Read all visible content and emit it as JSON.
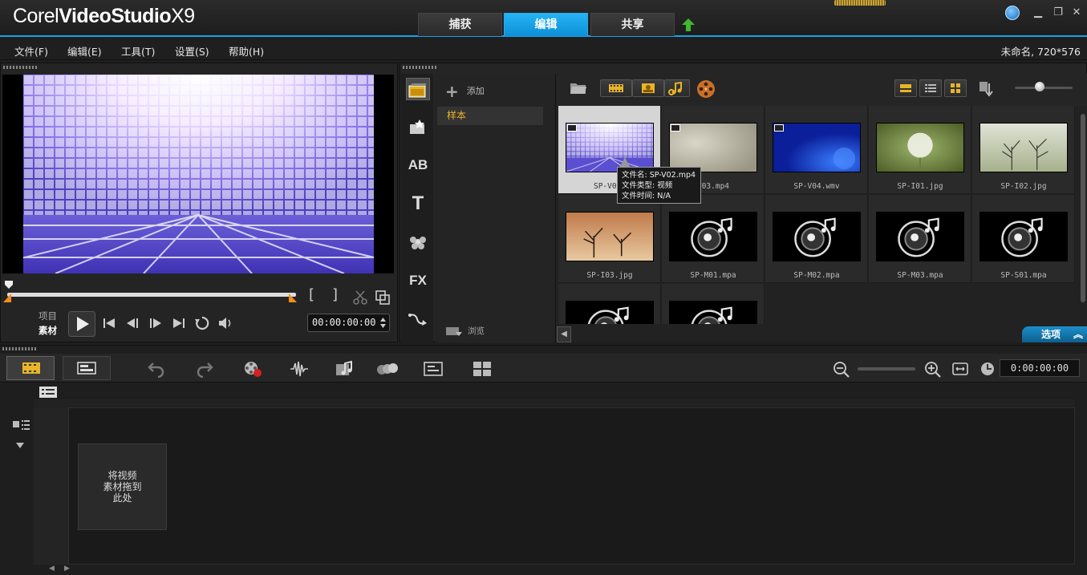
{
  "app": {
    "brand_1": "Corel",
    "brand_2": "VideoStudio",
    "brand_3": "X9",
    "accent": "#1aa2e6"
  },
  "mode_tabs": [
    {
      "label": "捕获",
      "active": false
    },
    {
      "label": "编辑",
      "active": true
    },
    {
      "label": "共享",
      "active": false
    }
  ],
  "menu": {
    "items": [
      "文件(F)",
      "编辑(E)",
      "工具(T)",
      "设置(S)",
      "帮助(H)"
    ],
    "project_info": "未命名, 720*576"
  },
  "player": {
    "mode_project": "项目",
    "mode_clip": "素材",
    "timecode": "00:00:00:00"
  },
  "library": {
    "add_label": "添加",
    "folder": "样本",
    "browse_label": "浏览",
    "options_label": "选项",
    "items": [
      {
        "name": "SP-V02.mp4",
        "label": "SP-V02.",
        "kind": "video",
        "selected": true
      },
      {
        "name": "SP-V03.mp4",
        "label": "V03.mp4",
        "kind": "video",
        "selected": false
      },
      {
        "name": "SP-V04.wmv",
        "label": "SP-V04.wmv",
        "kind": "video",
        "selected": false
      },
      {
        "name": "SP-I01.jpg",
        "label": "SP-I01.jpg",
        "kind": "image",
        "selected": false
      },
      {
        "name": "SP-I02.jpg",
        "label": "SP-I02.jpg",
        "kind": "image",
        "selected": false
      },
      {
        "name": "SP-I03.jpg",
        "label": "SP-I03.jpg",
        "kind": "image",
        "selected": false
      },
      {
        "name": "SP-M01.mpa",
        "label": "SP-M01.mpa",
        "kind": "audio",
        "selected": false
      },
      {
        "name": "SP-M02.mpa",
        "label": "SP-M02.mpa",
        "kind": "audio",
        "selected": false
      },
      {
        "name": "SP-M03.mpa",
        "label": "SP-M03.mpa",
        "kind": "audio",
        "selected": false
      },
      {
        "name": "SP-S01.mpa",
        "label": "SP-S01.mpa",
        "kind": "audio",
        "selected": false
      },
      {
        "name": "",
        "label": "",
        "kind": "audio",
        "selected": false
      },
      {
        "name": "",
        "label": "",
        "kind": "audio",
        "selected": false
      }
    ],
    "tooltip": {
      "line1": "文件名: SP-V02.mp4",
      "line2": "文件类型: 视频",
      "line3": "文件时间: N/A"
    }
  },
  "side_icons": [
    "media-icon",
    "instant-project-icon",
    "transition-icon",
    "title-icon",
    "graphics-icon",
    "filter-icon",
    "path-icon"
  ],
  "side_labels": {
    "transition": "AB",
    "title": "T",
    "filter": "FX"
  },
  "timeline": {
    "timecode": "0:00:00:00",
    "drop_hint_1": "将视频",
    "drop_hint_2": "素材拖到",
    "drop_hint_3": "此处"
  }
}
